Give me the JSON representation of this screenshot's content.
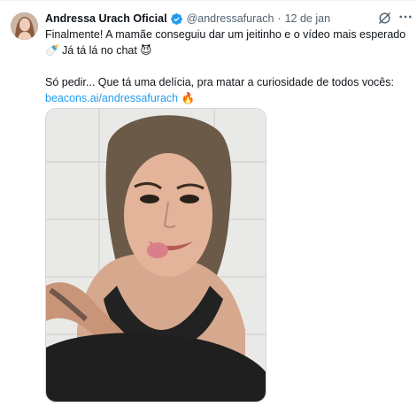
{
  "tweet": {
    "author_name": "Andressa Urach Oficial",
    "handle": "@andressafurach",
    "separator": "·",
    "date": "12 de jan",
    "line1": "Finalmente! A mamãe conseguiu dar um jeitinho e o vídeo mais esperado",
    "line2_emoji": "🍼",
    "line2_text": " Já tá lá no chat ",
    "line2_emoji_end": "😈",
    "line3": "Só pedir... Que tá uma delícia, pra matar a curiosidade de todos vocês:",
    "link": "beacons.ai/andressafurach",
    "link_emoji": "🔥"
  },
  "icons": {
    "verified": "verified-badge-icon",
    "grok": "grok-icon",
    "more": "more-options-icon"
  },
  "colors": {
    "text": "#0f1419",
    "secondary": "#536471",
    "link": "#1d9bf0",
    "verified": "#1d9bf0"
  }
}
